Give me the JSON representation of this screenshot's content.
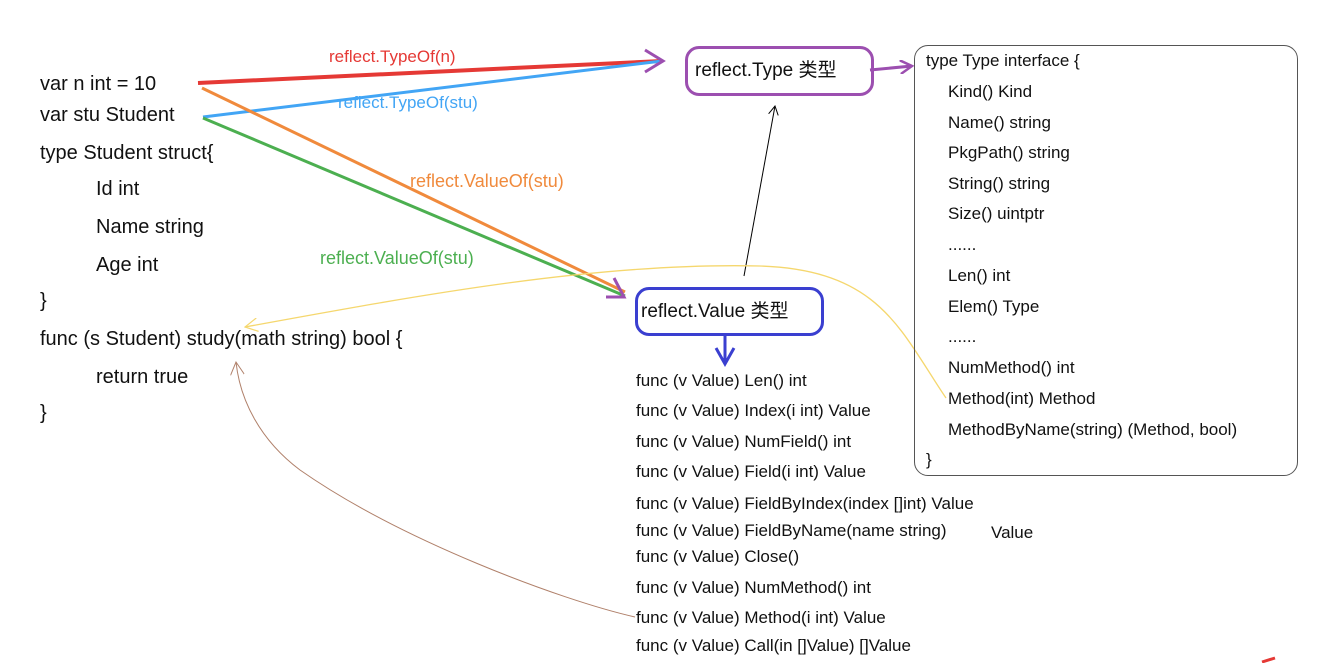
{
  "code_lines": [
    "var n int = 10",
    "var stu Student",
    "type Student struct{",
    "Id int",
    "Name string",
    "Age int",
    "}",
    "func (s Student) study(math string) bool {",
    "return true",
    "}"
  ],
  "arrow_labels": {
    "typeof_n": "reflect.TypeOf(n)",
    "typeof_stu": "reflect.TypeOf(stu)",
    "valueof_stu_orange": "reflect.ValueOf(stu)",
    "valueof_stu_green": "reflect.ValueOf(stu)"
  },
  "type_box": {
    "label": "reflect.Type 类型"
  },
  "value_box": {
    "label": "reflect.Value 类型"
  },
  "type_interface": [
    "type Type interface {",
    "Kind() Kind",
    "Name() string",
    "PkgPath() string",
    "String() string",
    "Size() uintptr",
    "......",
    "Len() int",
    "Elem() Type",
    "......",
    "NumMethod() int",
    "Method(int) Method",
    "MethodByName(string) (Method, bool)",
    "}"
  ],
  "value_methods": [
    "func (v Value) Len() int",
    "func (v Value) Index(i int) Value",
    "func (v Value) NumField() int",
    "func (v Value) Field(i int) Value",
    "func (v Value) FieldByIndex(index []int) Value",
    "func (v Value) FieldByName(name string)",
    "func (v Value) Close()",
    "func (v Value) NumMethod() int",
    "func (v Value) Method(i int) Value",
    "func (v Value) Call(in []Value) []Value"
  ],
  "value_methods_extra": "Value",
  "colors": {
    "typeof_n": "#e53935",
    "typeof_stu": "#42a5f5",
    "valueof_orange": "#f08a3c",
    "valueof_green": "#4caf50",
    "type_box_border": "#9c4fb0",
    "value_box_border": "#3a3fd0",
    "method_link_yellow": "#f5d76e",
    "call_link_brown": "#b0806a"
  }
}
